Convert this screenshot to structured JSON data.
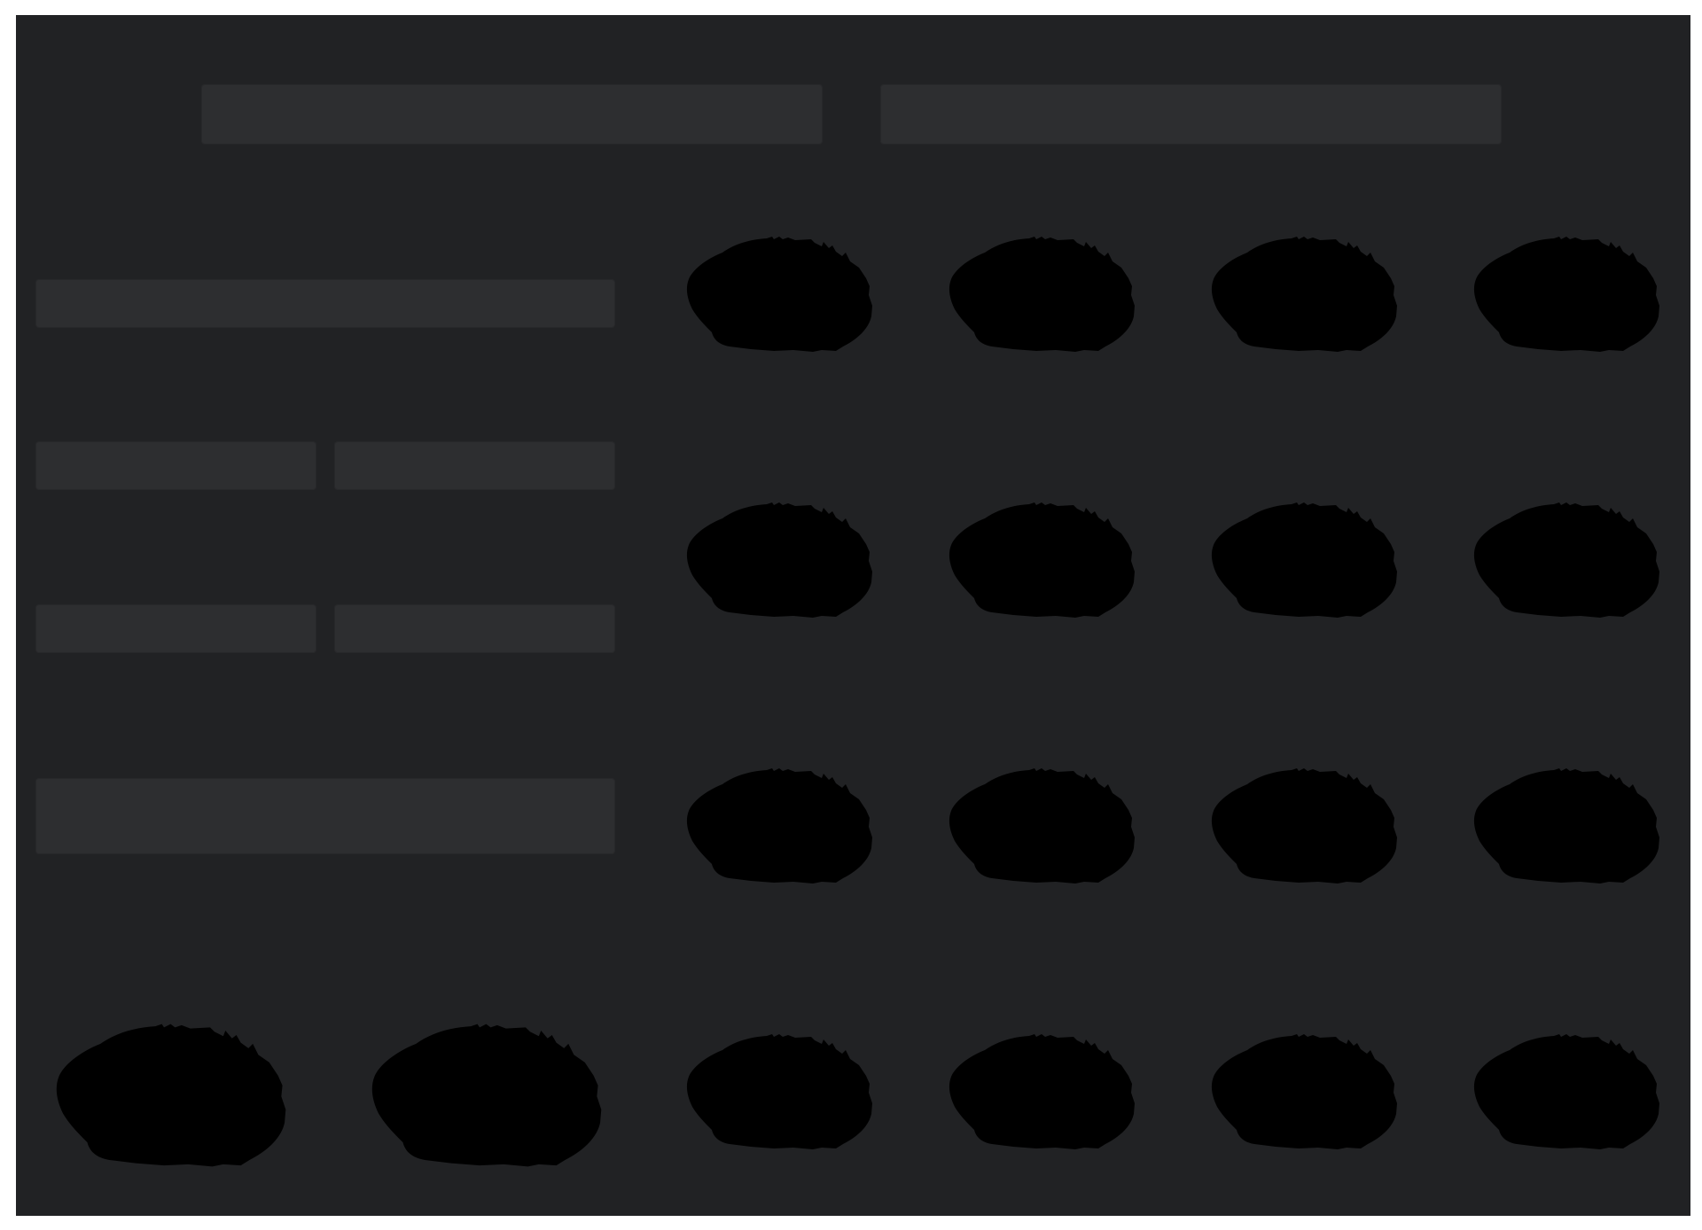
{
  "palette": {
    "page_background": "#ffffff",
    "panel_background": "#212224",
    "placeholder_fill": "#2d2e30",
    "token_fill": "#000000",
    "token_glyph": "#ffffff"
  },
  "top_bars": [
    {
      "label": ""
    },
    {
      "label": ""
    }
  ],
  "left_panel": {
    "field_row_1": {
      "label": ""
    },
    "field_row_2": [
      {
        "label": ""
      },
      {
        "label": ""
      }
    ],
    "field_row_3": [
      {
        "label": ""
      },
      {
        "label": ""
      }
    ],
    "field_row_4": {
      "label": ""
    }
  },
  "token_grid": {
    "rows": 4,
    "columns": 4,
    "icon": "unknown-question-mark-icon"
  },
  "bottom_left_tokens": {
    "count": 2,
    "icon": "unknown-question-mark-icon"
  }
}
